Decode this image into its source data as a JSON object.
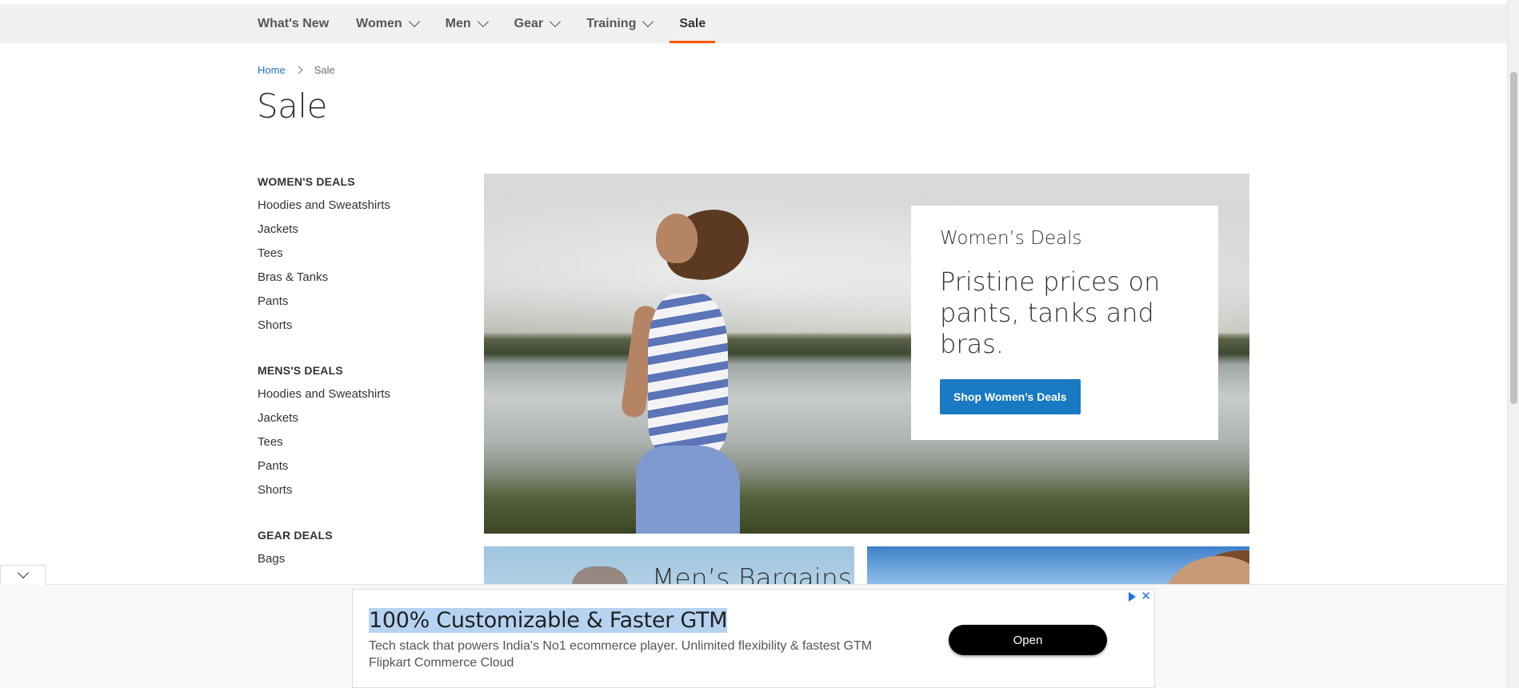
{
  "nav": {
    "items": [
      {
        "label": "What's New",
        "has_dropdown": false,
        "active": false
      },
      {
        "label": "Women",
        "has_dropdown": true,
        "active": false
      },
      {
        "label": "Men",
        "has_dropdown": true,
        "active": false
      },
      {
        "label": "Gear",
        "has_dropdown": true,
        "active": false
      },
      {
        "label": "Training",
        "has_dropdown": true,
        "active": false
      },
      {
        "label": "Sale",
        "has_dropdown": false,
        "active": true
      }
    ],
    "active_color": "#ff5501"
  },
  "breadcrumb": {
    "home": "Home",
    "current": "Sale"
  },
  "page_title": "Sale",
  "sidebar": {
    "womens": {
      "heading": "WOMEN'S DEALS",
      "links": [
        "Hoodies and Sweatshirts",
        "Jackets",
        "Tees",
        "Bras & Tanks",
        "Pants",
        "Shorts"
      ]
    },
    "mens": {
      "heading": "MENS'S DEALS",
      "links": [
        "Hoodies and Sweatshirts",
        "Jackets",
        "Tees",
        "Pants",
        "Shorts"
      ]
    },
    "gear": {
      "heading": "GEAR DEALS",
      "links": [
        "Bags"
      ]
    }
  },
  "hero": {
    "eyebrow": "Women’s Deals",
    "headline": "Pristine prices on pants, tanks and bras.",
    "button": "Shop Women’s Deals",
    "button_color": "#1979c3"
  },
  "promos": {
    "men_title": "Men’s Bargains"
  },
  "ad": {
    "title": "100% Customizable & Faster GTM",
    "body_line1": "Tech stack that powers India's No1 ecommerce player. Unlimited flexibility & fastest GTM",
    "body_line2": "Flipkart Commerce Cloud",
    "button": "Open",
    "close_glyph": "✕"
  },
  "colors": {
    "link": "#1979c3",
    "nav_bg": "#f0f0f0"
  }
}
